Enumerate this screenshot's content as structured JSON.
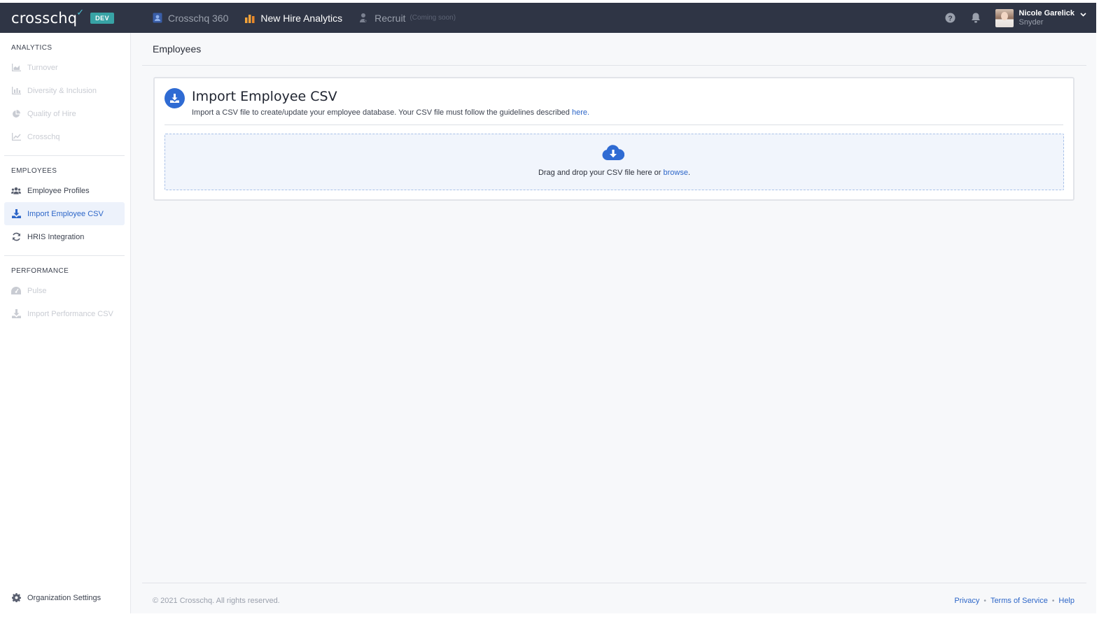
{
  "app": {
    "logo": "crosschq",
    "env_badge": "DEV"
  },
  "nav": {
    "tabs": [
      {
        "label": "Crosschq 360",
        "icon": "id-card-icon"
      },
      {
        "label": "New Hire Analytics",
        "icon": "bar-chart-icon",
        "active": true
      },
      {
        "label": "Recruit",
        "icon": "recruit-icon",
        "note": "(Coming soon)"
      }
    ]
  },
  "user": {
    "name": "Nicole Garelick",
    "subtitle": "Snyder"
  },
  "sidebar": {
    "sections": [
      {
        "title": "ANALYTICS",
        "items": [
          {
            "label": "Turnover",
            "icon": "area-chart-icon",
            "disabled": true
          },
          {
            "label": "Diversity & Inclusion",
            "icon": "bar-chart-icon",
            "disabled": true
          },
          {
            "label": "Quality of Hire",
            "icon": "pie-chart-icon",
            "disabled": true
          },
          {
            "label": "Crosschq",
            "icon": "line-chart-icon",
            "disabled": true
          }
        ]
      },
      {
        "title": "EMPLOYEES",
        "items": [
          {
            "label": "Employee Profiles",
            "icon": "users-icon"
          },
          {
            "label": "Import Employee CSV",
            "icon": "download-icon",
            "active": true
          },
          {
            "label": "HRIS Integration",
            "icon": "sync-icon"
          }
        ]
      },
      {
        "title": "PERFORMANCE",
        "items": [
          {
            "label": "Pulse",
            "icon": "gauge-icon",
            "disabled": true
          },
          {
            "label": "Import Performance CSV",
            "icon": "download-icon",
            "disabled": true
          }
        ]
      }
    ],
    "settings_label": "Organization Settings"
  },
  "page": {
    "title": "Employees",
    "card": {
      "title": "Import Employee CSV",
      "desc_prefix": "Import a CSV file to create/update your employee database. Your CSV file must follow the guidelines described ",
      "desc_link": "here",
      "desc_suffix": ".",
      "drop_prefix": "Drag and drop your CSV file here or ",
      "drop_link": "browse",
      "drop_suffix": "."
    }
  },
  "footer": {
    "copyright": "© 2021 Crosschq. All rights reserved.",
    "links": [
      "Privacy",
      "Terms of Service",
      "Help"
    ]
  },
  "colors": {
    "topbar": "#2f3545",
    "accent": "#2d66c8",
    "badge": "#38a3a5"
  }
}
